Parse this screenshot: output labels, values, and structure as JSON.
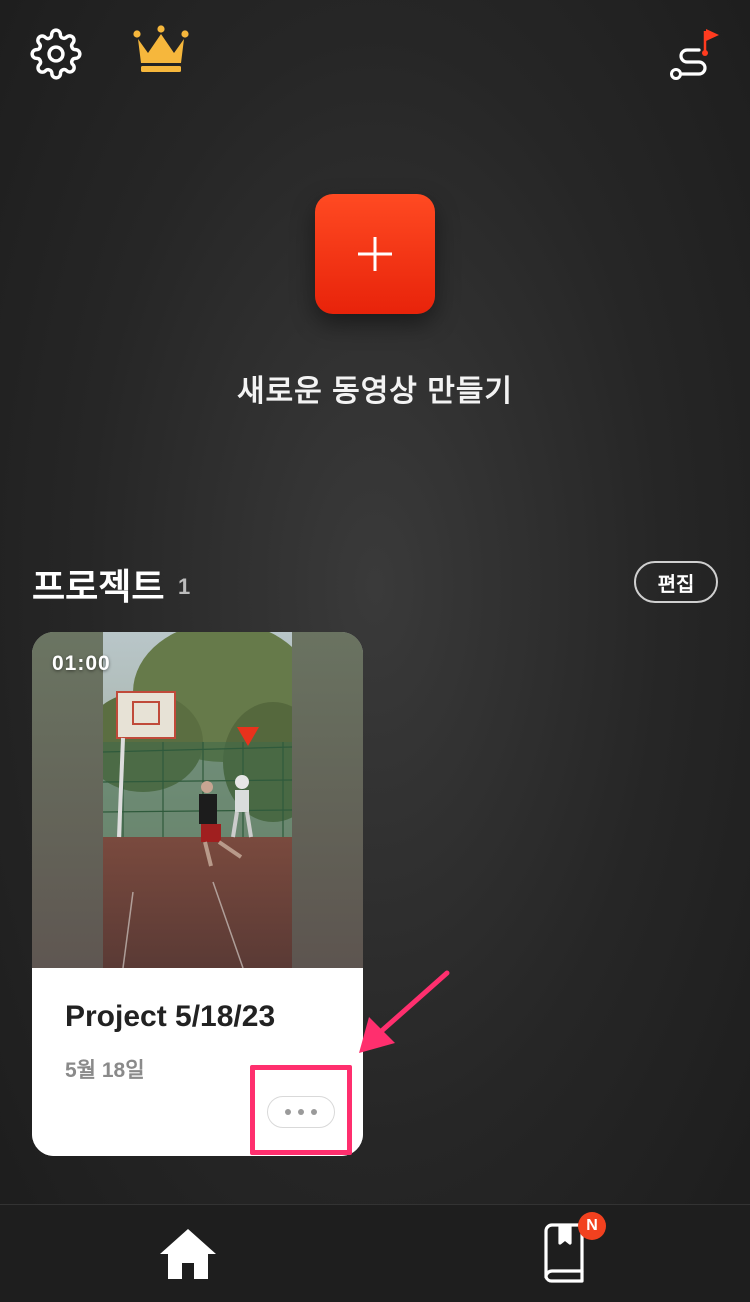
{
  "topbar": {
    "icons": {
      "settings": "gear-icon",
      "premium": "crown-icon",
      "route": "route-flag-icon"
    }
  },
  "create": {
    "label": "새로운 동영상 만들기",
    "icon": "plus-icon",
    "color": "#f23a1b"
  },
  "projects": {
    "title": "프로젝트",
    "count": "1",
    "edit_label": "편집",
    "items": [
      {
        "duration": "01:00",
        "name": "Project 5/18/23",
        "date": "5월 18일",
        "more_icon": "more-horizontal-icon"
      }
    ]
  },
  "annotation": {
    "color": "#ff2f6e"
  },
  "bottom_nav": {
    "home_icon": "home-icon",
    "guide_icon": "book-icon",
    "badge": "N"
  }
}
